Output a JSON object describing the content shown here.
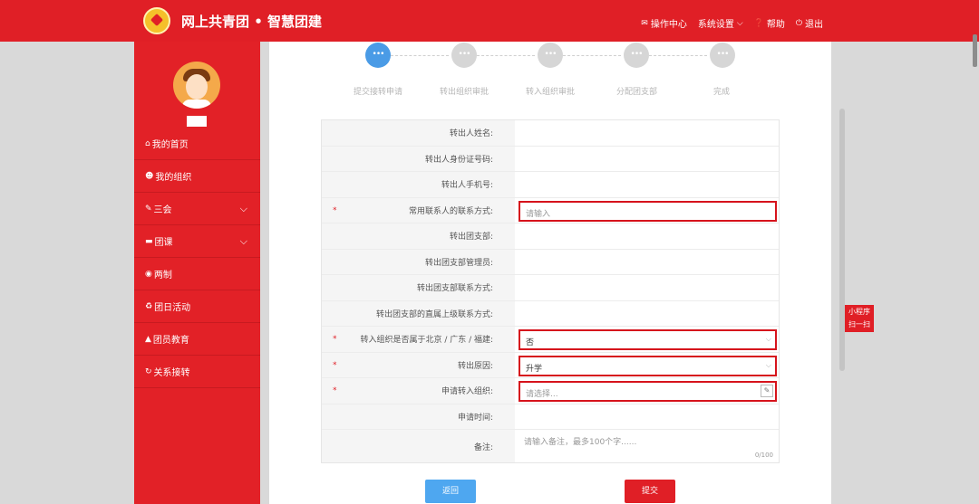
{
  "header": {
    "brand": "网上共青团 • 智慧团建",
    "nav": {
      "ops_center": "操作中心",
      "system_settings": "系统设置",
      "help": "帮助",
      "logout": "退出"
    }
  },
  "sidebar": {
    "items": [
      {
        "label": "我的首页",
        "icon": "home-icon"
      },
      {
        "label": "我的组织",
        "icon": "group-icon"
      },
      {
        "label": "三会",
        "icon": "edit-icon"
      },
      {
        "label": "团课",
        "icon": "folder-icon"
      },
      {
        "label": "两制",
        "icon": "target-icon"
      },
      {
        "label": "团日活动",
        "icon": "recycle-icon"
      },
      {
        "label": "团员教育",
        "icon": "graduation-icon"
      },
      {
        "label": "关系接转",
        "icon": "refresh-icon"
      }
    ]
  },
  "steps": [
    "提交接转申请",
    "转出组织审批",
    "转入组织审批",
    "分配团支部",
    "完成"
  ],
  "form": {
    "labels": {
      "out_name": "转出人姓名:",
      "out_id": "转出人身份证号码:",
      "out_phone": "转出人手机号:",
      "contact": "常用联系人的联系方式:",
      "out_branch": "转出团支部:",
      "out_admin": "转出团支部管理员:",
      "out_branch_contact": "转出团支部联系方式:",
      "out_superior_contact": "转出团支部的直属上级联系方式:",
      "in_region": "转入组织是否属于北京 / 广东 / 福建:",
      "reason": "转出原因:",
      "in_org": "申请转入组织:",
      "apply_time": "申请时间:",
      "remark": "备注:"
    },
    "required_mark": "*",
    "contact_placeholder": "请输入",
    "in_region_value": "否",
    "reason_value": "升学",
    "in_org_placeholder": "请选择...",
    "remark_placeholder": "请输入备注，最多100个字......",
    "remark_counter": "0/100"
  },
  "buttons": {
    "back": "返回",
    "submit": "提交"
  },
  "mini_program": {
    "line1": "小程序",
    "line2": "扫一扫"
  },
  "colors": {
    "primary_red": "#e01f26",
    "step_active": "#4a9be6",
    "back_button": "#4ea7f0"
  }
}
